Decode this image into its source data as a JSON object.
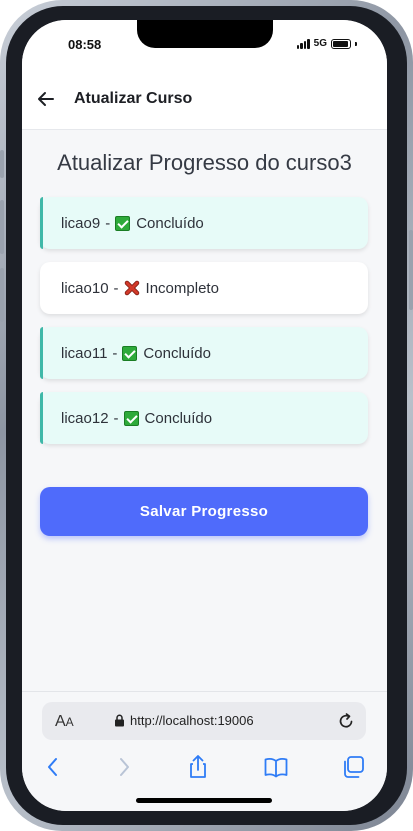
{
  "status_bar": {
    "time": "08:58",
    "network": "5G"
  },
  "header": {
    "title": "Atualizar Curso"
  },
  "page": {
    "title": "Atualizar Progresso do curso3"
  },
  "lessons": [
    {
      "name": "licao9",
      "separator": "-",
      "status": "Concluído",
      "done": true
    },
    {
      "name": "licao10",
      "separator": "-",
      "status": "Incompleto",
      "done": false
    },
    {
      "name": "licao11",
      "separator": "-",
      "status": "Concluído",
      "done": true
    },
    {
      "name": "licao12",
      "separator": "-",
      "status": "Concluído",
      "done": true
    }
  ],
  "save_button": {
    "label": "Salvar Progresso"
  },
  "browser": {
    "text_size_label_large": "A",
    "text_size_label_small": "A",
    "url": "http://localhost:19006"
  },
  "colors": {
    "accent": "#4f6bfb",
    "done_bg": "#e7fbf8",
    "done_border": "#3fb8a8",
    "check_green": "#2eaa3a",
    "cross_red": "#d23a2a"
  },
  "icons": {
    "back": "arrow-left-icon",
    "done": "check-box-icon",
    "incomplete": "cross-mark-icon",
    "lock": "lock-icon",
    "reload": "reload-icon",
    "nav": [
      "chevron-left-icon",
      "chevron-right-icon",
      "share-icon",
      "book-icon",
      "tabs-icon"
    ]
  }
}
